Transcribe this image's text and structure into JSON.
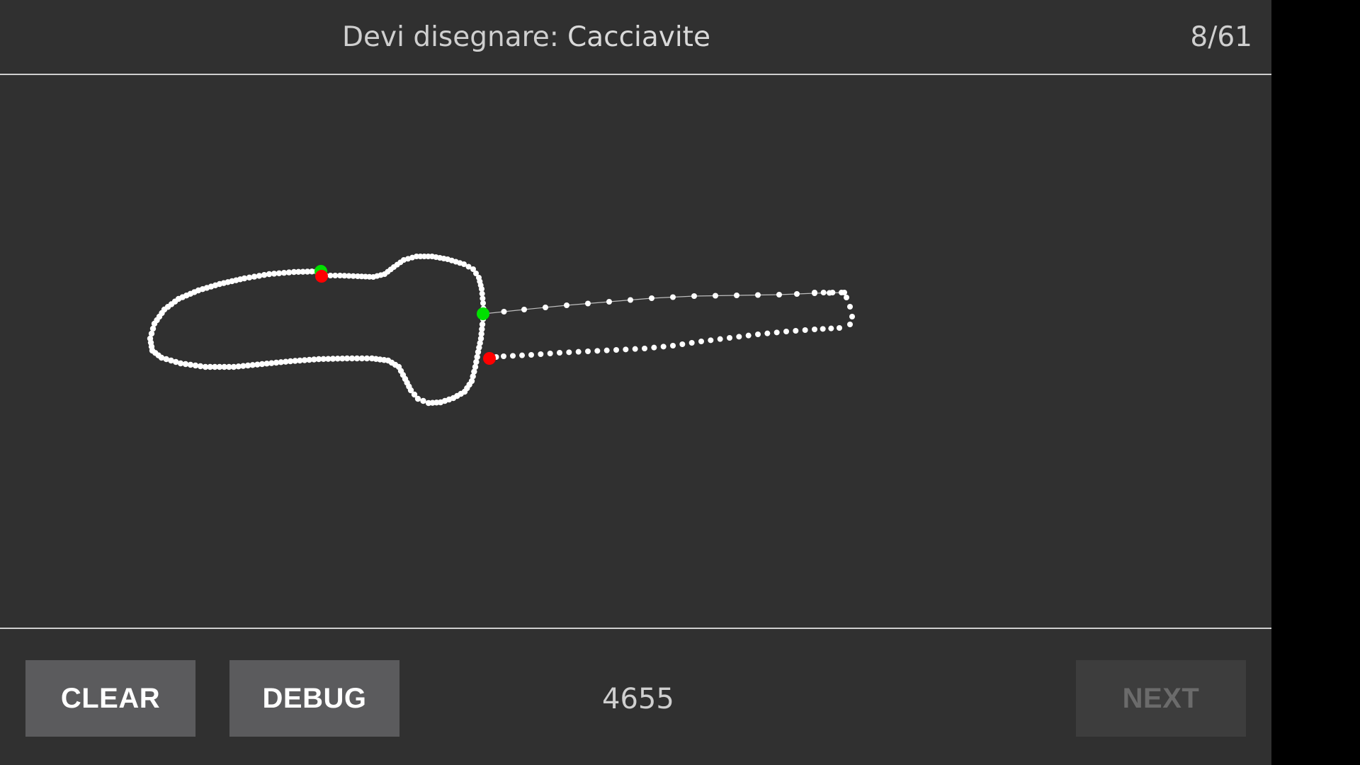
{
  "header": {
    "prompt_label": "Devi disegnare:",
    "prompt_word": "Cacciavite",
    "counter": "8/61"
  },
  "footer": {
    "clear_label": "CLEAR",
    "debug_label": "DEBUG",
    "score": "4655",
    "next_label": "NEXT",
    "next_enabled": false
  },
  "colors": {
    "background": "#303030",
    "stroke_point": "#ffffff",
    "start_marker": "#00e000",
    "end_marker": "#ff0000",
    "button": "#5b5b5d",
    "button_disabled": "#3d3d3d"
  }
}
